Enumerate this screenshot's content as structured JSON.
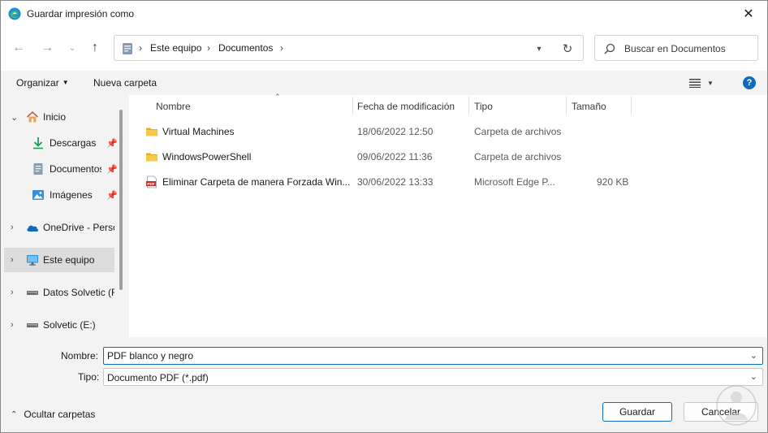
{
  "window": {
    "title": "Guardar impresión como"
  },
  "address": {
    "crumbs": [
      "Este equipo",
      "Documentos"
    ]
  },
  "search": {
    "placeholder": "Buscar en Documentos"
  },
  "commands": {
    "organize": "Organizar",
    "new_folder": "Nueva carpeta",
    "help": "?"
  },
  "nav_pane": {
    "items": [
      {
        "label": "Inicio",
        "icon": "home-icon"
      },
      {
        "label": "Descargas",
        "icon": "download-icon",
        "pinned": true
      },
      {
        "label": "Documentos",
        "icon": "documents-icon",
        "pinned": true
      },
      {
        "label": "Imágenes",
        "icon": "pictures-icon",
        "pinned": true
      },
      {
        "label": "OneDrive - Personal",
        "icon": "cloud-icon"
      },
      {
        "label": "Este equipo",
        "icon": "computer-icon",
        "selected": true
      },
      {
        "label": "Datos Solvetic (F:)",
        "icon": "drive-icon"
      },
      {
        "label": "Solvetic (E:)",
        "icon": "drive-icon"
      }
    ]
  },
  "file_list": {
    "columns": [
      "Nombre",
      "Fecha de modificación",
      "Tipo",
      "Tamaño"
    ],
    "rows": [
      {
        "name": "Virtual Machines",
        "date": "18/06/2022 12:50",
        "type": "Carpeta de archivos",
        "size": "",
        "icon": "folder-icon"
      },
      {
        "name": "WindowsPowerShell",
        "date": "09/06/2022 11:36",
        "type": "Carpeta de archivos",
        "size": "",
        "icon": "folder-icon"
      },
      {
        "name": "Eliminar Carpeta de manera Forzada Win...",
        "date": "30/06/2022 13:33",
        "type": "Microsoft Edge P...",
        "size": "920 KB",
        "icon": "pdf-icon"
      }
    ]
  },
  "form": {
    "name_label": "Nombre:",
    "name_value": "PDF blanco y negro",
    "type_label": "Tipo:",
    "type_value": "Documento PDF (*.pdf)",
    "hide_folders": "Ocultar carpetas",
    "save": "Guardar",
    "cancel": "Cancelar"
  },
  "colors": {
    "accent": "#0f6cbd",
    "folder": "#f5c242",
    "pdf": "#c4302b",
    "pane_bg": "#f3f3f3"
  }
}
